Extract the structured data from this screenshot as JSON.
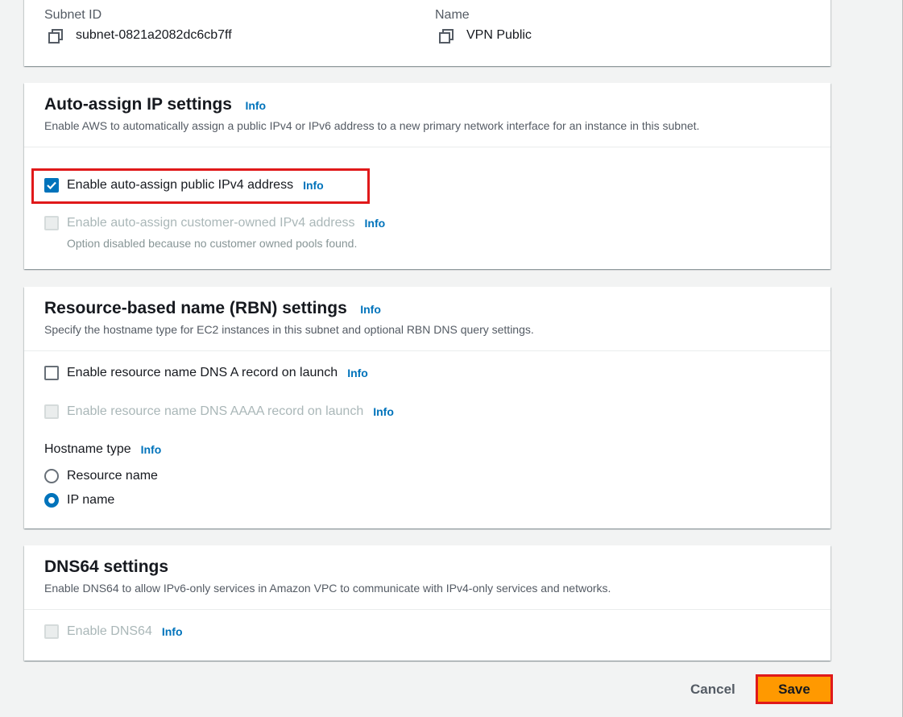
{
  "subnet_card": {
    "subnet_id_label": "Subnet ID",
    "subnet_id_value": "subnet-0821a2082dc6cb7ff",
    "name_label": "Name",
    "name_value": "VPN Public"
  },
  "auto_assign": {
    "title": "Auto-assign IP settings",
    "info": "Info",
    "description": "Enable AWS to automatically assign a public IPv4 or IPv6 address to a new primary network interface for an instance in this subnet.",
    "ipv4_label": "Enable auto-assign public IPv4 address",
    "ipv4_checked": true,
    "customer_owned_label": "Enable auto-assign customer-owned IPv4 address",
    "customer_owned_note": "Option disabled because no customer owned pools found."
  },
  "rbn": {
    "title": "Resource-based name (RBN) settings",
    "info": "Info",
    "description": "Specify the hostname type for EC2 instances in this subnet and optional RBN DNS query settings.",
    "dns_a_label": "Enable resource name DNS A record on launch",
    "dns_aaaa_label": "Enable resource name DNS AAAA record on launch",
    "hostname_type_label": "Hostname type",
    "options": [
      "Resource name",
      "IP name"
    ],
    "selected_option": "IP name"
  },
  "dns64": {
    "title": "DNS64 settings",
    "description": "Enable DNS64 to allow IPv6-only services in Amazon VPC to communicate with IPv4-only services and networks.",
    "enable_label": "Enable DNS64",
    "info": "Info"
  },
  "footer": {
    "cancel_label": "Cancel",
    "save_label": "Save"
  },
  "colors": {
    "accent": "#0073bb",
    "save_button": "#ff9900",
    "highlight": "#e0191a"
  }
}
